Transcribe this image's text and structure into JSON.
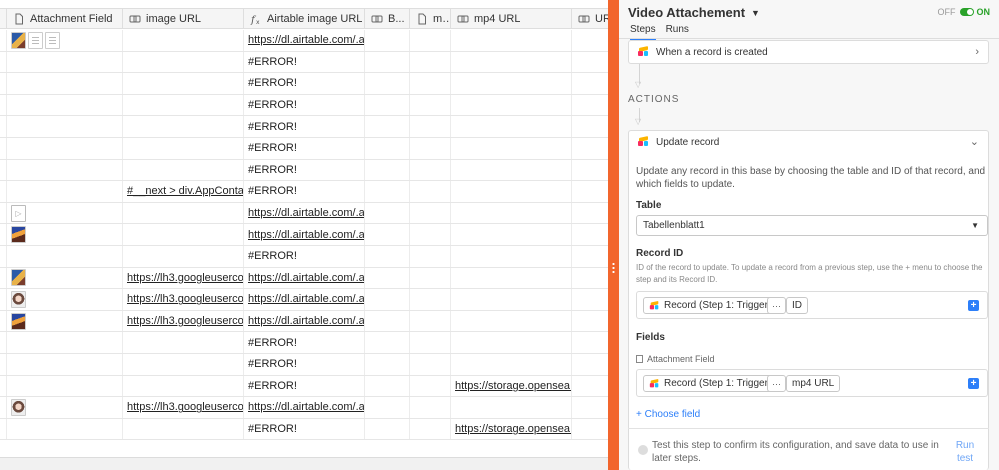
{
  "grid": {
    "columns": [
      {
        "key": "attachment",
        "label": "Attachment Field",
        "icon": "document-icon"
      },
      {
        "key": "image_url",
        "label": "image URL",
        "icon": "lookup-icon"
      },
      {
        "key": "airtable_url",
        "label": "Airtable image URL",
        "icon": "formula-icon"
      },
      {
        "key": "b",
        "label": "B...",
        "icon": "lookup-icon"
      },
      {
        "key": "m",
        "label": "m...",
        "icon": "document-icon"
      },
      {
        "key": "mp4",
        "label": "mp4 URL",
        "icon": "lookup-icon"
      },
      {
        "key": "url",
        "label": "URL",
        "icon": "lookup-icon"
      }
    ],
    "rows": [
      {
        "attachment": [
          "image",
          "document",
          "document"
        ],
        "image_url": "",
        "airtable_url": "https://dl.airtable.com/.at...",
        "mp4": ""
      },
      {
        "attachment": [],
        "image_url": "",
        "airtable_url": "#ERROR!",
        "mp4": ""
      },
      {
        "attachment": [],
        "image_url": "",
        "airtable_url": "#ERROR!",
        "mp4": ""
      },
      {
        "attachment": [],
        "image_url": "",
        "airtable_url": "#ERROR!",
        "mp4": ""
      },
      {
        "attachment": [],
        "image_url": "",
        "airtable_url": "#ERROR!",
        "mp4": ""
      },
      {
        "attachment": [],
        "image_url": "",
        "airtable_url": "#ERROR!",
        "mp4": ""
      },
      {
        "attachment": [],
        "image_url": "",
        "airtable_url": "#ERROR!",
        "mp4": ""
      },
      {
        "attachment": [],
        "image_url": "#__next > div.AppContain...",
        "airtable_url": "#ERROR!",
        "mp4": ""
      },
      {
        "attachment": [
          "video"
        ],
        "image_url": "",
        "airtable_url": "https://dl.airtable.com/.at...",
        "mp4": ""
      },
      {
        "attachment": [
          "image"
        ],
        "image_url": "",
        "airtable_url": "https://dl.airtable.com/.at...",
        "mp4": ""
      },
      {
        "attachment": [],
        "image_url": "",
        "airtable_url": "#ERROR!",
        "mp4": ""
      },
      {
        "attachment": [
          "image"
        ],
        "image_url": "https://lh3.googleusercon...",
        "airtable_url": "https://dl.airtable.com/.at...",
        "mp4": ""
      },
      {
        "attachment": [
          "portrait"
        ],
        "image_url": "https://lh3.googleusercon...",
        "airtable_url": "https://dl.airtable.com/.at...",
        "mp4": ""
      },
      {
        "attachment": [
          "image"
        ],
        "image_url": "https://lh3.googleusercon...",
        "airtable_url": "https://dl.airtable.com/.at...",
        "mp4": ""
      },
      {
        "attachment": [],
        "image_url": "",
        "airtable_url": "#ERROR!",
        "mp4": ""
      },
      {
        "attachment": [],
        "image_url": "",
        "airtable_url": "#ERROR!",
        "mp4": ""
      },
      {
        "attachment": [],
        "image_url": "",
        "airtable_url": "#ERROR!",
        "mp4": "https://storage.opensea.i..."
      },
      {
        "attachment": [
          "portrait"
        ],
        "image_url": "https://lh3.googleusercon...",
        "airtable_url": "https://dl.airtable.com/.at...",
        "mp4": ""
      },
      {
        "attachment": [],
        "image_url": "",
        "airtable_url": "#ERROR!",
        "mp4": "https://storage.opensea.i..."
      }
    ]
  },
  "panel": {
    "title": "Video Attachement",
    "toggle_off": "OFF",
    "toggle_on": "ON",
    "tabs": [
      "Steps",
      "Runs"
    ],
    "trigger_label": "When a record is created",
    "actions_heading": "ACTIONS",
    "action_label": "Update record",
    "description": "Update any record in this base by choosing the table and ID of that record, and which fields to update.",
    "table_label": "Table",
    "table_value": "Tabellenblatt1",
    "record_id_label": "Record ID",
    "record_id_hint": "ID of the record to update. To update a record from a previous step, use the + menu to choose the step and its Record ID.",
    "record_id_token": {
      "source": "Record (Step 1: Trigger)",
      "dots": "···",
      "field": "ID"
    },
    "fields_label": "Fields",
    "field_name": "Attachment Field",
    "field_token": {
      "source": "Record (Step 1: Trigger)",
      "dots": "···",
      "field": "mp4 URL"
    },
    "choose_field": "+ Choose field",
    "test_message": "Test this step to confirm its configuration, and save data to use in later steps.",
    "run_test": "Run test",
    "colors": {
      "accent": "#2d7ff9",
      "splitter": "#f2652c",
      "toggle_on": "#2aa22a"
    }
  }
}
